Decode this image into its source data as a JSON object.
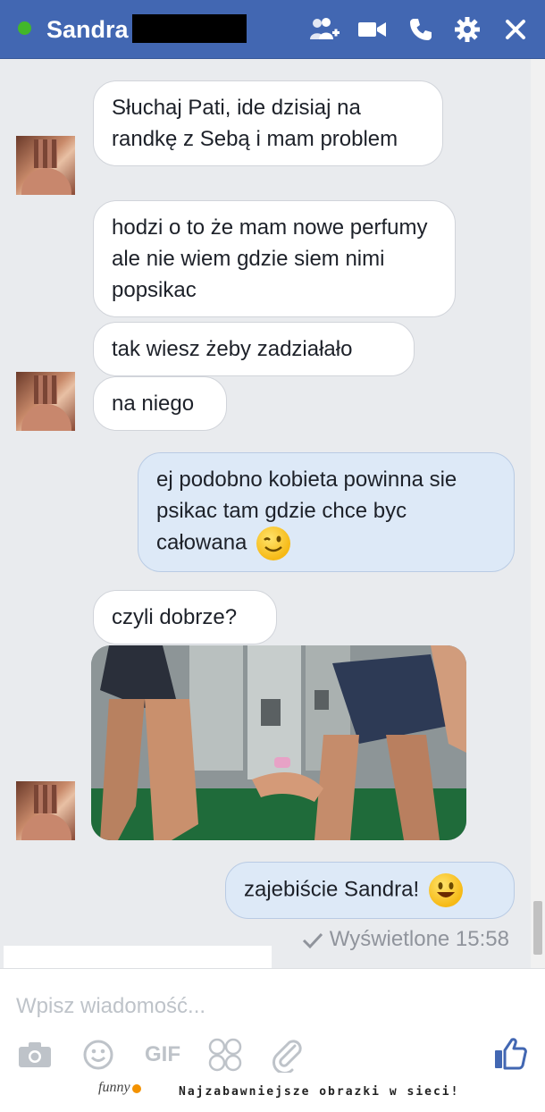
{
  "header": {
    "contact_name": "Sandra",
    "online_status_color": "#42b72a",
    "icons": [
      "add-people-icon",
      "video-call-icon",
      "phone-icon",
      "gear-icon",
      "close-icon"
    ]
  },
  "messages": [
    {
      "from": "contact",
      "text": "Słuchaj Pati, ide dzisiaj na randkę z Sebą i mam problem"
    },
    {
      "from": "contact",
      "text": "hodzi o to że mam nowe perfumy ale nie wiem gdzie siem nimi popsikac"
    },
    {
      "from": "contact",
      "text": "tak wiesz żeby zadziałało"
    },
    {
      "from": "contact",
      "text": "na niego"
    },
    {
      "from": "me",
      "text": "ej podobno kobieta powinna sie psikac tam gdzie chce byc całowana",
      "emoji": "wink"
    },
    {
      "from": "contact",
      "text": "czyli dobrze?"
    },
    {
      "from": "contact",
      "type": "photo"
    },
    {
      "from": "me",
      "text": "zajebiście Sandra!",
      "emoji": "smile"
    }
  ],
  "seen_status": "Wyświetlone 15:58",
  "composer": {
    "placeholder": "Wpisz wiadomość...",
    "gif_label": "GIF",
    "tools": [
      "camera-icon",
      "emoji-icon",
      "gif-button",
      "sticker-icon",
      "attachment-icon",
      "like-icon"
    ]
  },
  "footer": {
    "brand": "funny",
    "tagline": "Najzabawniejsze obrazki w sieci!"
  }
}
